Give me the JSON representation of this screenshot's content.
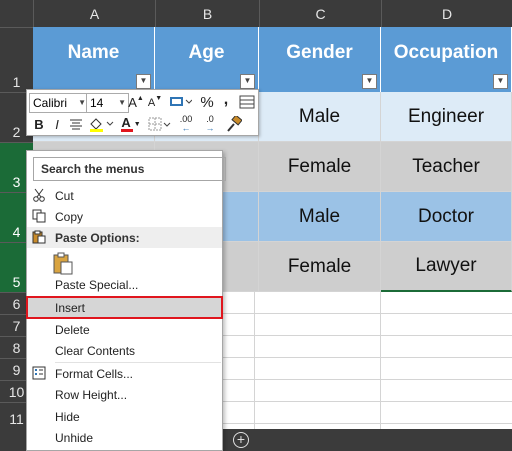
{
  "columns": [
    "A",
    "B",
    "C",
    "D"
  ],
  "rows": [
    "1",
    "2",
    "3",
    "4",
    "5",
    "6",
    "7",
    "8",
    "9",
    "10",
    "11"
  ],
  "table": {
    "headers": [
      "Name",
      "Age",
      "Gender",
      "Occupation"
    ],
    "rows": [
      [
        "",
        "",
        "Male",
        "Engineer"
      ],
      [
        "",
        "",
        "Female",
        "Teacher"
      ],
      [
        "",
        "",
        "Male",
        "Doctor"
      ],
      [
        "",
        "",
        "Female",
        "Lawyer"
      ]
    ]
  },
  "mini_toolbar": {
    "font_name": "Calibri",
    "font_size": "14",
    "grow_font": "A",
    "shrink_font": "A",
    "percent": "%",
    "comma": ",",
    "bold": "B",
    "italic": "I",
    "font_color": "A",
    "inc_decimal": ".00",
    "dec_decimal": ".0"
  },
  "context_menu": {
    "search_placeholder": "Search the menus",
    "items": [
      {
        "label": "Cut",
        "icon": "scissors-icon"
      },
      {
        "label": "Copy",
        "icon": "copy-icon"
      },
      {
        "label": "Paste Options:",
        "icon": "paste-icon"
      },
      {
        "label": "",
        "icon": "paste-clipboard-icon"
      },
      {
        "label": "Paste Special...",
        "icon": ""
      },
      {
        "label": "Insert",
        "icon": ""
      },
      {
        "label": "Delete",
        "icon": ""
      },
      {
        "label": "Clear Contents",
        "icon": ""
      },
      {
        "label": "Format Cells...",
        "icon": "format-cells-icon"
      },
      {
        "label": "Row Height...",
        "icon": ""
      },
      {
        "label": "Hide",
        "icon": ""
      },
      {
        "label": "Unhide",
        "icon": ""
      }
    ]
  },
  "sheet_tabs": {
    "add_label": "+"
  },
  "colors": {
    "header_fill": "#5b9bd5",
    "row_light": "#ddebf7",
    "row_grey": "#cecece",
    "row_blue": "#9bc2e6",
    "selected_row_header": "#1b6b37",
    "highlight_outline": "#e0161e"
  }
}
